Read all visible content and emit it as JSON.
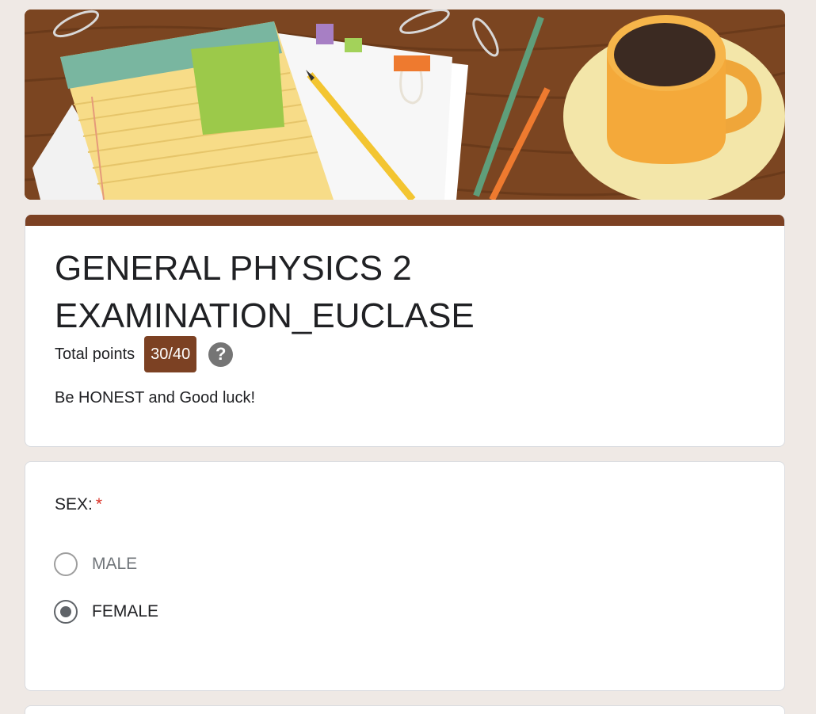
{
  "form": {
    "title": "GENERAL PHYSICS 2 EXAMINATION_EUCLASE",
    "points_label": "Total points",
    "points_value": "30/40",
    "description": "Be HONEST and Good luck!",
    "accent_color": "#7c4123"
  },
  "question": {
    "title": "SEX:",
    "required_marker": "*",
    "options": [
      {
        "label": "MALE",
        "selected": false
      },
      {
        "label": "FEMALE",
        "selected": true
      }
    ]
  },
  "icons": {
    "help": "help-circle-icon",
    "radio_empty": "radio-unselected-icon",
    "radio_checked": "radio-selected-icon"
  }
}
